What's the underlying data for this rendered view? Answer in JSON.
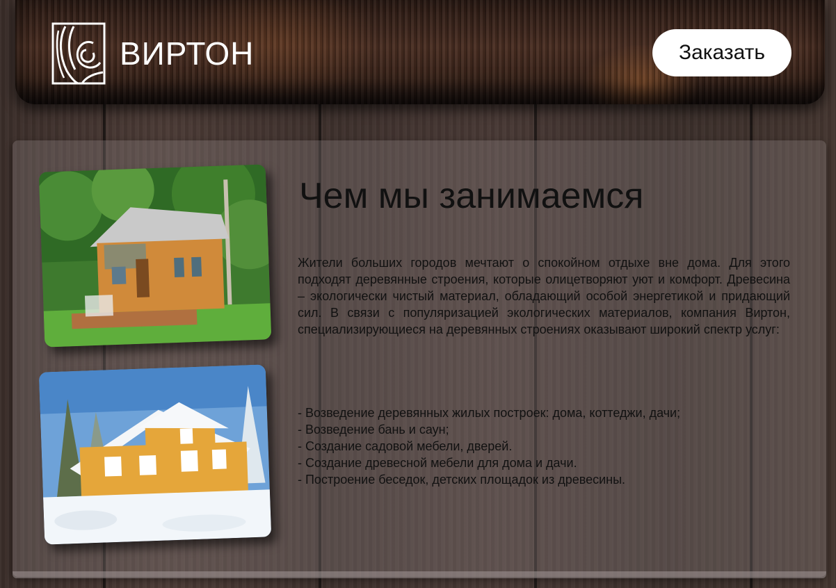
{
  "header": {
    "brand": "ВИРТОН",
    "order_button": "Заказать"
  },
  "about": {
    "title": "Чем мы занимаемся",
    "paragraph": "Жители больших городов мечтают о спокойном отдыхе вне дома. Для этого подходят деревянные строения, которые олицетворяют уют и комфорт. Древесина – экологически чистый материал, обладающий особой энергетикой и придающий сил. В связи с популяризацией экологических материалов, компания Виртон, специализирующиеся на деревянных строениях оказывают широкий спектр услуг:",
    "services": [
      "- Возведение деревянных жилых построек: дома, коттеджи, дачи;",
      "- Возведение бань и саун;",
      "- Создание садовой мебели, дверей.",
      "- Создание древесной мебели для дома и дачи.",
      "- Построение беседок, детских площадок из древесины."
    ]
  },
  "icons": {
    "logo": "wood-rings-logo-icon"
  },
  "colors": {
    "accent": "#ffffff",
    "text": "#111111"
  }
}
